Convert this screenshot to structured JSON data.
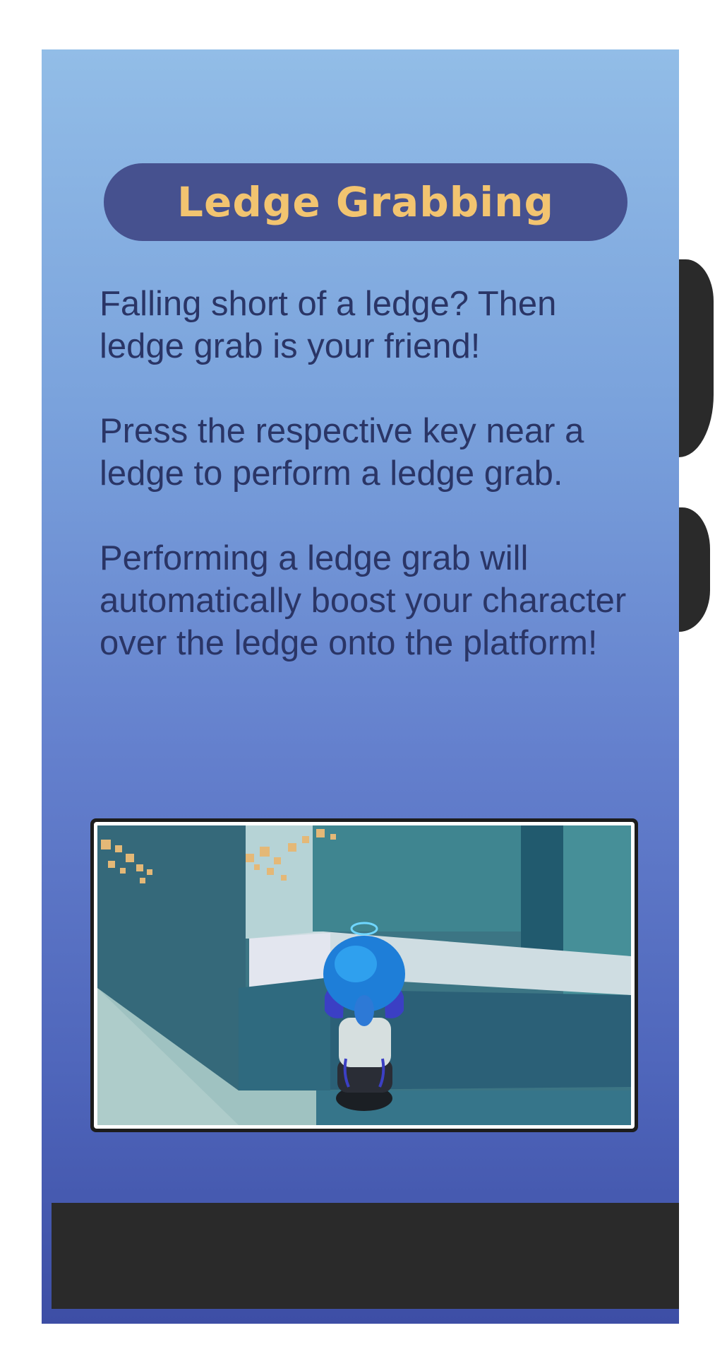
{
  "card": {
    "title": "Ledge Grabbing",
    "paragraphs": [
      "Falling short of a ledge? Then ledge grab is your friend!",
      "Press the respective key near a ledge to perform a ledge grab.",
      "Performing a ledge grab will automatically boost your character over the ledge onto the platform!"
    ]
  },
  "colors": {
    "panel_top": "#92bde7",
    "panel_bottom": "#3d4ea5",
    "title_pill": "#46518f",
    "title_text": "#f2c470",
    "body_text": "#2a3566",
    "dark_bar": "#2a2a2a"
  },
  "icons": {
    "screenshot": "ledge-grab-gameplay-image"
  }
}
